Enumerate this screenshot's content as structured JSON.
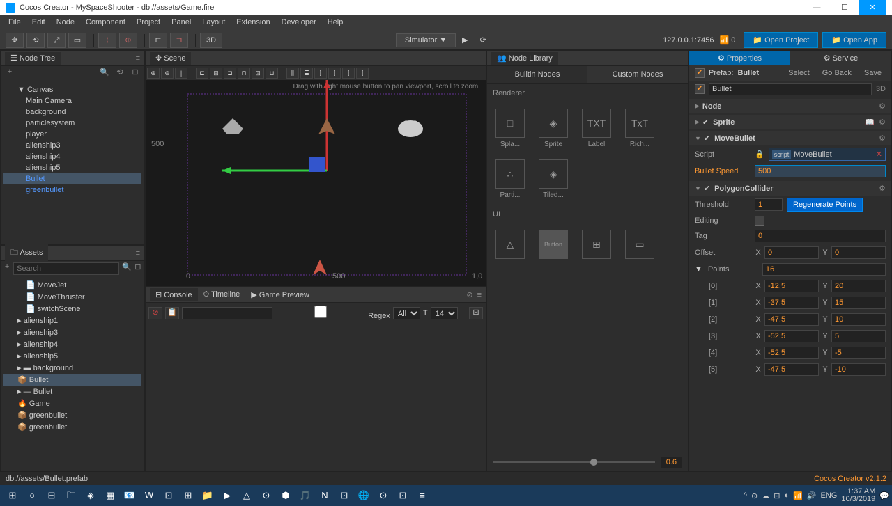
{
  "title": "Cocos Creator - MySpaceShooter - db://assets/Game.fire",
  "menu": [
    "File",
    "Edit",
    "Node",
    "Component",
    "Project",
    "Panel",
    "Layout",
    "Extension",
    "Developer",
    "Help"
  ],
  "toolbar": {
    "mode3d": "3D",
    "simulator": "Simulator ▼",
    "ip": "127.0.0.1:7456",
    "openProject": "Open Project",
    "openApp": "Open App"
  },
  "nodetree": {
    "title": "Node Tree",
    "root": "Canvas",
    "items": [
      "Main Camera",
      "background",
      "particlesystem",
      "player",
      "alienship3",
      "alienship4",
      "alienship5",
      "Bullet",
      "greenbullet"
    ],
    "selectedIndex": 7
  },
  "assets": {
    "title": "Assets",
    "searchPlaceholder": "Search",
    "items": [
      "MoveJet",
      "MoveThruster",
      "switchScene",
      "alienship1",
      "alienship3",
      "alienship4",
      "alienship5",
      "background",
      "Bullet",
      "Bullet",
      "Game",
      "greenbullet",
      "greenbullet"
    ],
    "selectedIndex": 8
  },
  "scene": {
    "title": "Scene",
    "hint": "Drag with right mouse button to pan viewport, scroll to zoom.",
    "ruler": {
      "y": "500",
      "x0": "0",
      "x1": "500",
      "x2": "1,0"
    }
  },
  "console": {
    "tab1": "Console",
    "tab2": "Timeline",
    "tab3": "Game Preview",
    "regex": "Regex",
    "all": "All",
    "fontSize": "14"
  },
  "nodelib": {
    "title": "Node Library",
    "tab1": "Builtin Nodes",
    "tab2": "Custom Nodes",
    "section1": "Renderer",
    "section2": "UI",
    "items1": [
      "Spla...",
      "Sprite",
      "Label",
      "Rich..."
    ],
    "items2": [
      "Parti...",
      "Tiled..."
    ],
    "icons": [
      "□",
      "◈",
      "TXT",
      "TxT"
    ],
    "sliderVal": "0.6"
  },
  "properties": {
    "tab1": "Properties",
    "tab2": "Service",
    "prefabLabel": "Prefab:",
    "prefabName": "Bullet",
    "btnSelect": "Select",
    "btnGoBack": "Go Back",
    "btnSave": "Save",
    "nodeName": "Bullet",
    "mode3d": "3D",
    "sections": {
      "node": "Node",
      "sprite": "Sprite",
      "movebullet": "MoveBullet",
      "polygon": "PolygonCollider"
    },
    "script": {
      "label": "Script",
      "tag": "script",
      "value": "MoveBullet"
    },
    "bulletSpeed": {
      "label": "Bullet Speed",
      "value": "500"
    },
    "threshold": {
      "label": "Threshold",
      "value": "1"
    },
    "regenerate": "Regenerate Points",
    "editing": "Editing",
    "tag": {
      "label": "Tag",
      "value": "0"
    },
    "offset": {
      "label": "Offset",
      "x": "0",
      "y": "0"
    },
    "points": {
      "label": "Points",
      "count": "16"
    },
    "pointData": [
      {
        "idx": "[0]",
        "x": "-12.5",
        "y": "20"
      },
      {
        "idx": "[1]",
        "x": "-37.5",
        "y": "15"
      },
      {
        "idx": "[2]",
        "x": "-47.5",
        "y": "10"
      },
      {
        "idx": "[3]",
        "x": "-52.5",
        "y": "5"
      },
      {
        "idx": "[4]",
        "x": "-52.5",
        "y": "-5"
      },
      {
        "idx": "[5]",
        "x": "-47.5",
        "y": "-10"
      }
    ]
  },
  "statusbar": {
    "path": "db://assets/Bullet.prefab",
    "version": "Cocos Creator v2.1.2"
  },
  "taskbar": {
    "lang": "ENG",
    "time": "1:37 AM",
    "date": "10/3/2019"
  }
}
